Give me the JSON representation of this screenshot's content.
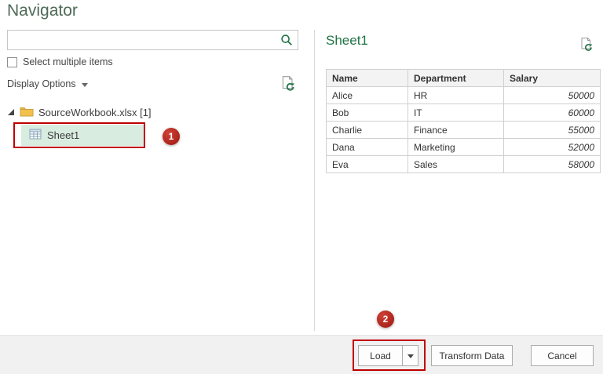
{
  "dialog": {
    "title": "Navigator"
  },
  "left_panel": {
    "search": {
      "value": "",
      "placeholder": ""
    },
    "select_multiple_label": "Select multiple items",
    "display_options_label": "Display Options",
    "tree": {
      "workbook_label": "SourceWorkbook.xlsx [1]",
      "sheet_label": "Sheet1"
    }
  },
  "preview": {
    "title": "Sheet1",
    "table": {
      "columns": [
        "Name",
        "Department",
        "Salary"
      ],
      "rows": [
        [
          "Alice",
          "HR",
          "50000"
        ],
        [
          "Bob",
          "IT",
          "60000"
        ],
        [
          "Charlie",
          "Finance",
          "55000"
        ],
        [
          "Dana",
          "Marketing",
          "52000"
        ],
        [
          "Eva",
          "Sales",
          "58000"
        ]
      ]
    }
  },
  "footer": {
    "load_label": "Load",
    "transform_data_label": "Transform Data",
    "cancel_label": "Cancel"
  },
  "annotations": {
    "step1": "1",
    "step2": "2"
  },
  "colors": {
    "accent_green": "#217346",
    "selection_green": "#d9ece0",
    "annotation_red": "#c00000"
  }
}
